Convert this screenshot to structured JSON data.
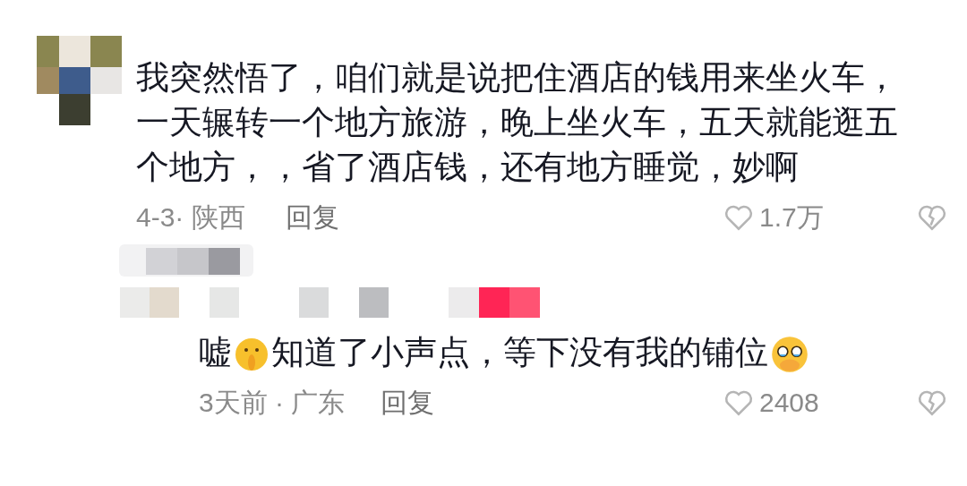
{
  "comments": [
    {
      "text": [
        {
          "kind": "text",
          "text": "我突然悟了，咱们就是说把住酒店的钱用来坐火车，一天辗转一个地方旅游，晚上坐火车，五天就能逛五个地方，，省了酒店钱，还有地方睡觉，妙啊"
        }
      ],
      "time": "4-3· 陕西",
      "reply": "回复",
      "likes": "1.7万",
      "author_liked": true,
      "replies": [
        {
          "text": [
            {
              "kind": "text",
              "text": "嘘"
            },
            {
              "kind": "shush"
            },
            {
              "kind": "text",
              "text": "知道了小声点，等下没有我的铺位"
            },
            {
              "kind": "plead"
            }
          ],
          "time": "3天前 · 广东",
          "reply": "回复",
          "likes": "2408"
        }
      ]
    }
  ]
}
